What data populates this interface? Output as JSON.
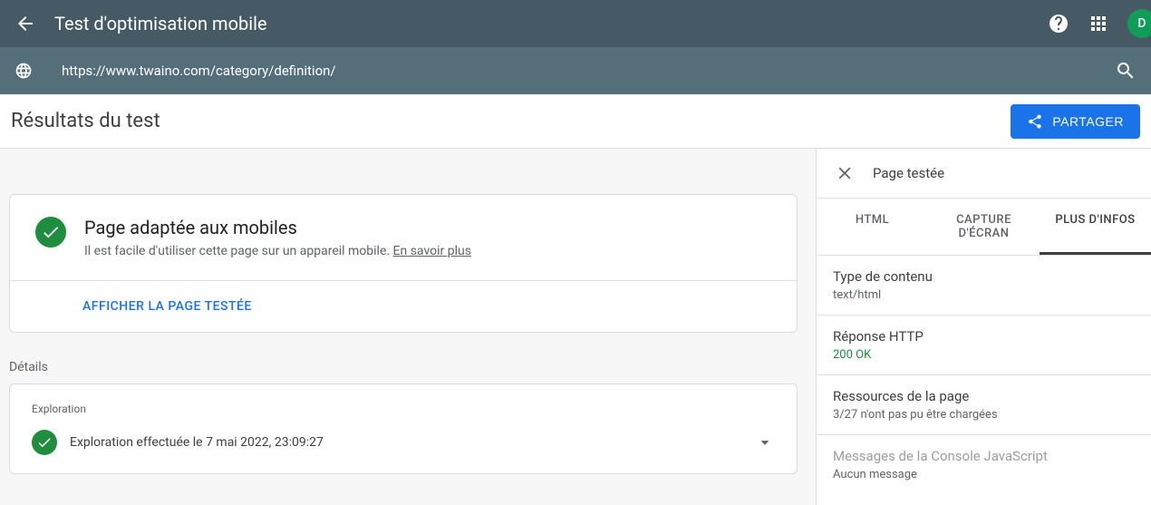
{
  "header": {
    "title": "Test d'optimisation mobile",
    "url": "https://www.twaino.com/category/definition/",
    "avatar_initial": "D"
  },
  "subheader": {
    "title": "Résultats du test",
    "share_label": "PARTAGER"
  },
  "result": {
    "title": "Page adaptée aux mobiles",
    "description": "Il est facile d'utiliser cette page sur un appareil mobile. ",
    "learn_more": "En savoir plus",
    "action": "AFFICHER LA PAGE TESTÉE"
  },
  "details": {
    "section_label": "Détails",
    "exploration_label": "Exploration",
    "exploration_text": "Exploration effectuée le 7 mai 2022, 23:09:27"
  },
  "side": {
    "panel_title": "Page testée",
    "tabs": {
      "html": "HTML",
      "screenshot": "CAPTURE D'ÉCRAN",
      "more": "PLUS D'INFOS"
    },
    "content_type_label": "Type de contenu",
    "content_type_value": "text/html",
    "http_label": "Réponse HTTP",
    "http_value": "200 OK",
    "resources_label": "Ressources de la page",
    "resources_value": "3/27 n'ont pas pu être chargées",
    "console_label": "Messages de la Console JavaScript",
    "console_value": "Aucun message"
  }
}
